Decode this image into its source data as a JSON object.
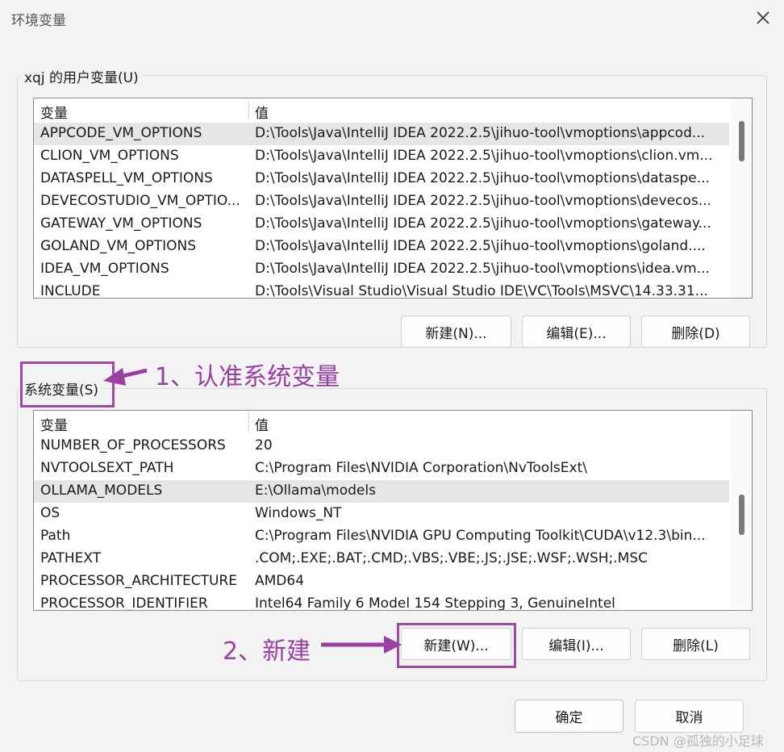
{
  "window": {
    "title": "环境变量"
  },
  "user_vars": {
    "label": "xqj 的用户变量(U)",
    "col_var": "变量",
    "col_val": "值",
    "rows": [
      {
        "name": "APPCODE_VM_OPTIONS",
        "value": "D:\\Tools\\Java\\IntelliJ IDEA 2022.2.5\\jihuo-tool\\vmoptions\\appcod..."
      },
      {
        "name": "CLION_VM_OPTIONS",
        "value": "D:\\Tools\\Java\\IntelliJ IDEA 2022.2.5\\jihuo-tool\\vmoptions\\clion.vm..."
      },
      {
        "name": "DATASPELL_VM_OPTIONS",
        "value": "D:\\Tools\\Java\\IntelliJ IDEA 2022.2.5\\jihuo-tool\\vmoptions\\dataspe..."
      },
      {
        "name": "DEVECOSTUDIO_VM_OPTIO...",
        "value": "D:\\Tools\\Java\\IntelliJ IDEA 2022.2.5\\jihuo-tool\\vmoptions\\devecos..."
      },
      {
        "name": "GATEWAY_VM_OPTIONS",
        "value": "D:\\Tools\\Java\\IntelliJ IDEA 2022.2.5\\jihuo-tool\\vmoptions\\gateway..."
      },
      {
        "name": "GOLAND_VM_OPTIONS",
        "value": "D:\\Tools\\Java\\IntelliJ IDEA 2022.2.5\\jihuo-tool\\vmoptions\\goland...."
      },
      {
        "name": "IDEA_VM_OPTIONS",
        "value": "D:\\Tools\\Java\\IntelliJ IDEA 2022.2.5\\jihuo-tool\\vmoptions\\idea.vm..."
      },
      {
        "name": "INCLUDE",
        "value": "D:\\Tools\\Visual Studio\\Visual Studio IDE\\VC\\Tools\\MSVC\\14.33.31..."
      }
    ],
    "new_btn": "新建(N)...",
    "edit_btn": "编辑(E)...",
    "delete_btn": "删除(D)"
  },
  "sys_vars": {
    "label": "系统变量(S)",
    "col_var": "变量",
    "col_val": "值",
    "rows": [
      {
        "name": "NUMBER_OF_PROCESSORS",
        "value": "20"
      },
      {
        "name": "NVTOOLSEXT_PATH",
        "value": "C:\\Program Files\\NVIDIA Corporation\\NvToolsExt\\"
      },
      {
        "name": "OLLAMA_MODELS",
        "value": "E:\\Ollama\\models"
      },
      {
        "name": "OS",
        "value": "Windows_NT"
      },
      {
        "name": "Path",
        "value": "C:\\Program Files\\NVIDIA GPU Computing Toolkit\\CUDA\\v12.3\\bin..."
      },
      {
        "name": "PATHEXT",
        "value": ".COM;.EXE;.BAT;.CMD;.VBS;.VBE;.JS;.JSE;.WSF;.WSH;.MSC"
      },
      {
        "name": "PROCESSOR_ARCHITECTURE",
        "value": "AMD64"
      },
      {
        "name": "PROCESSOR_IDENTIFIER",
        "value": "Intel64 Family 6 Model 154 Stepping 3, GenuineIntel"
      }
    ],
    "new_btn": "新建(W)...",
    "edit_btn": "编辑(I)...",
    "delete_btn": "删除(L)"
  },
  "footer": {
    "ok_btn": "确定",
    "cancel_btn": "取消"
  },
  "annotations": {
    "step1": "1、认准系统变量",
    "step2": "2、新建",
    "color": "#9a3fa3"
  },
  "watermark": "CSDN @孤独的小足球"
}
